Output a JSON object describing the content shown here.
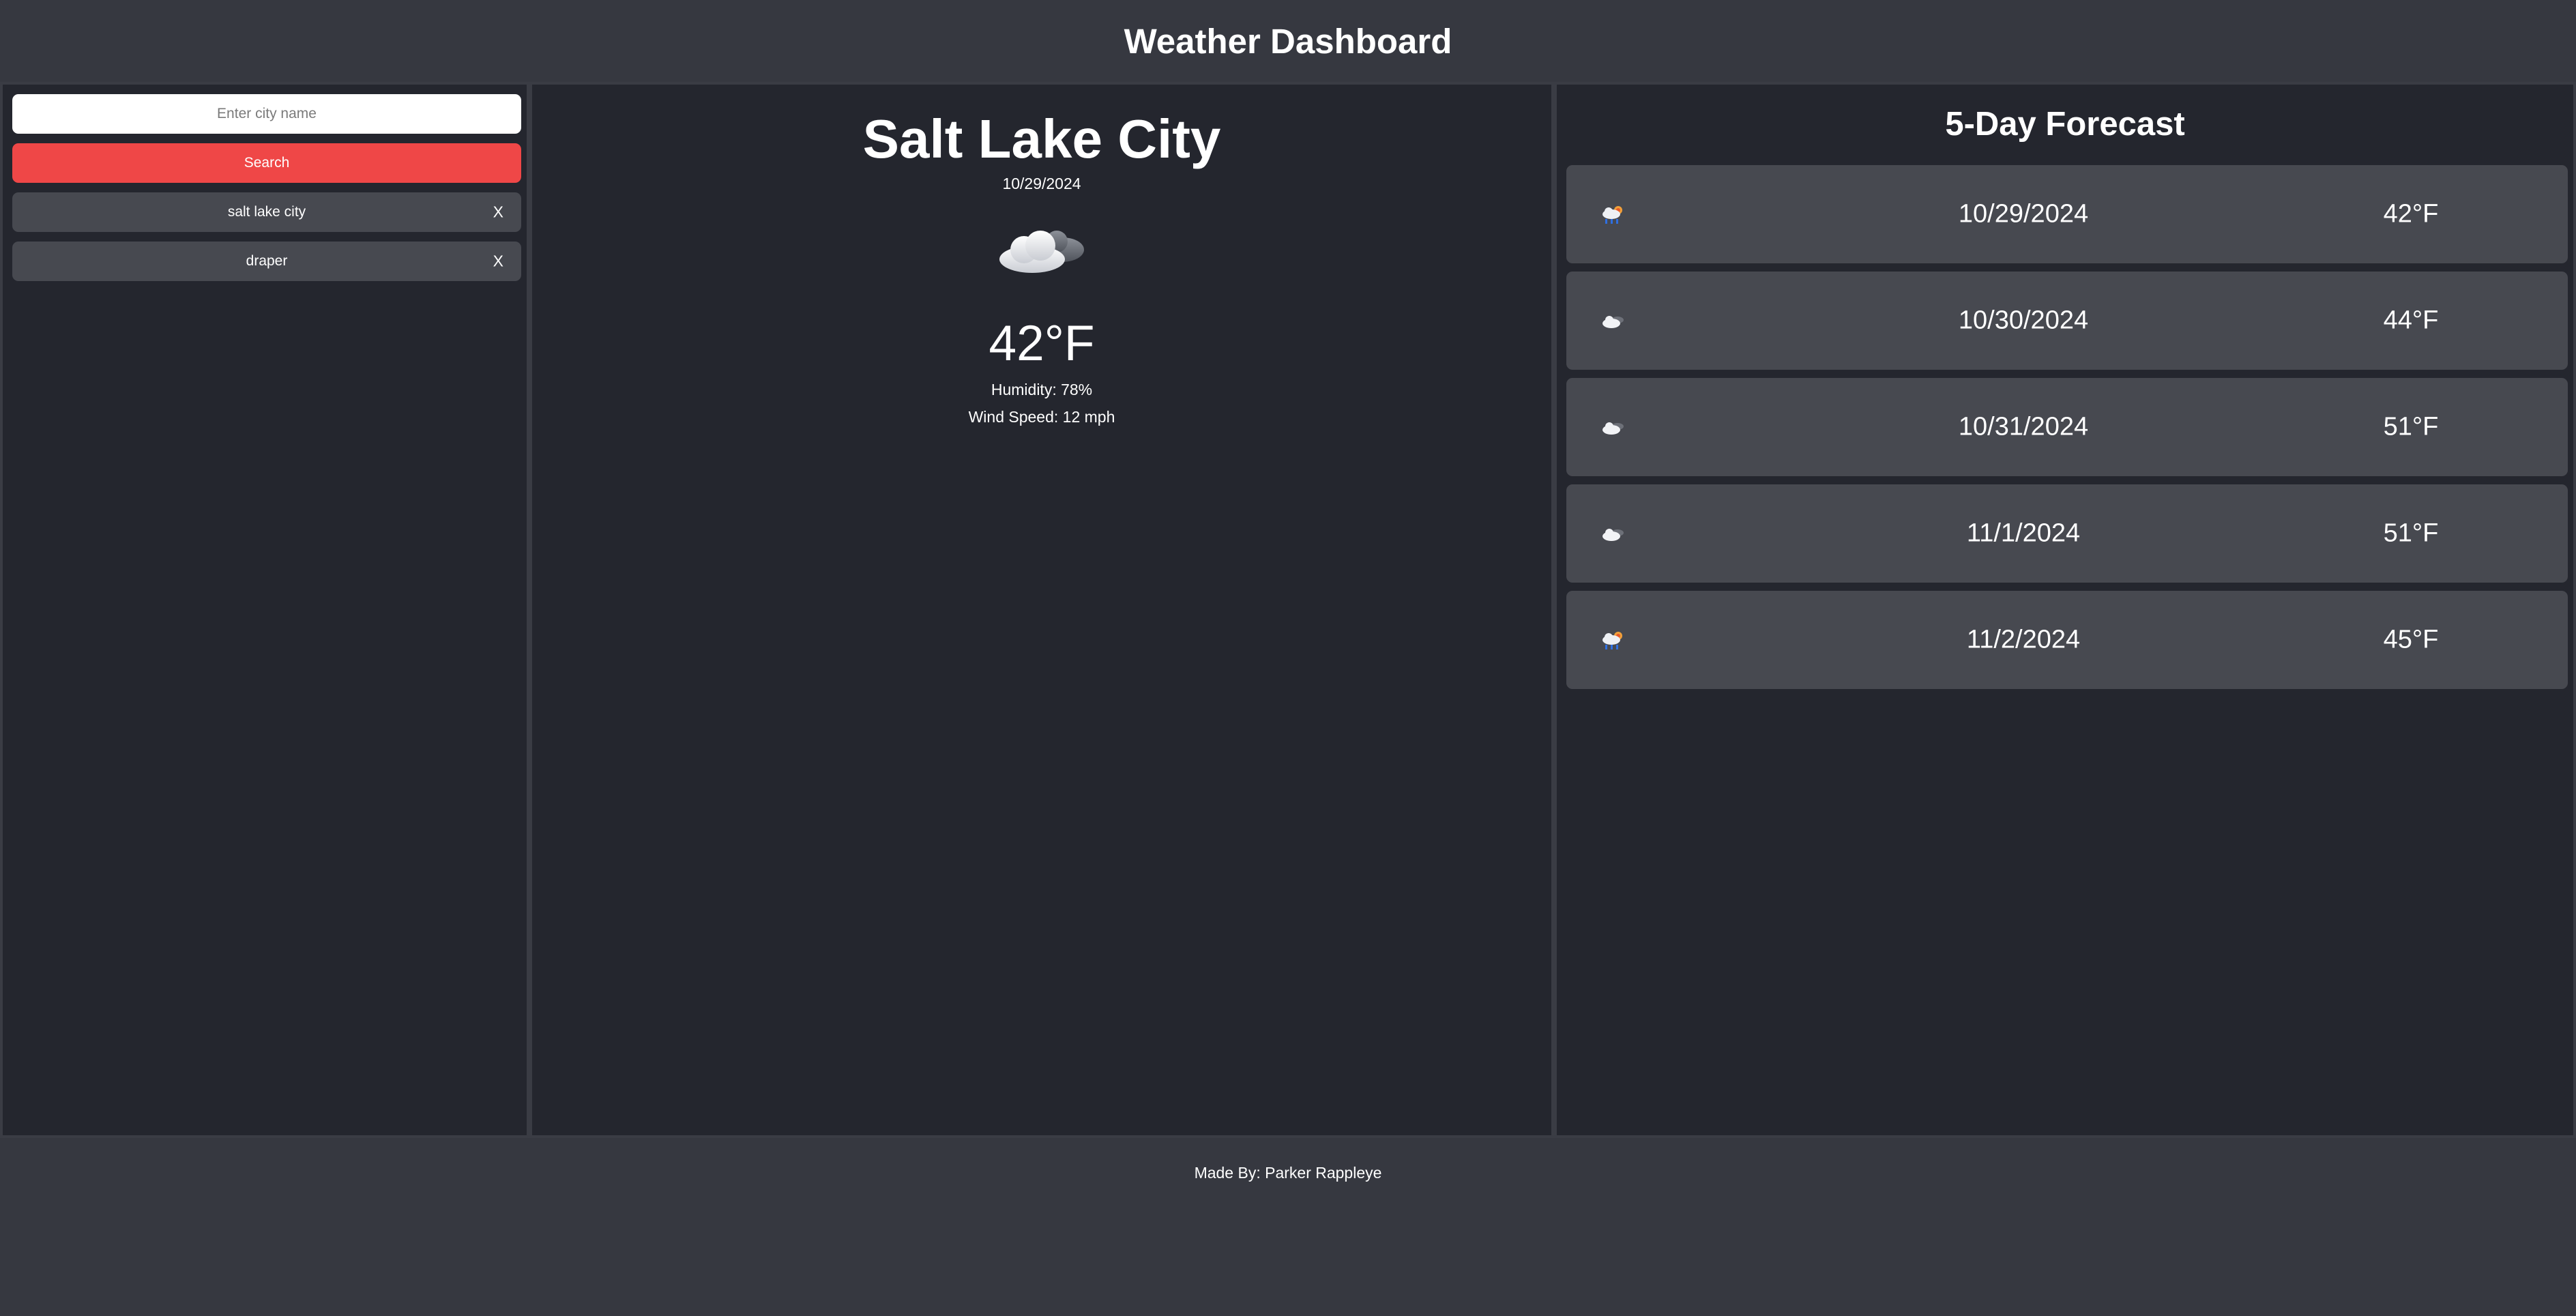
{
  "header": {
    "title": "Weather Dashboard"
  },
  "sidebar": {
    "search": {
      "placeholder": "Enter city name",
      "value": ""
    },
    "search_button_label": "Search",
    "history": [
      {
        "label": "salt lake city",
        "remove_label": "X"
      },
      {
        "label": "draper",
        "remove_label": "X"
      }
    ]
  },
  "current": {
    "city": "Salt Lake City",
    "date": "10/29/2024",
    "icon": "partly-cloudy-icon",
    "temperature": "42°F",
    "humidity": "Humidity: 78%",
    "wind": "Wind Speed: 12 mph"
  },
  "forecast": {
    "title": "5-Day Forecast",
    "days": [
      {
        "date": "10/29/2024",
        "temp": "42°F",
        "icon": "rain-icon"
      },
      {
        "date": "10/30/2024",
        "temp": "44°F",
        "icon": "partly-cloudy-icon"
      },
      {
        "date": "10/31/2024",
        "temp": "51°F",
        "icon": "partly-cloudy-icon"
      },
      {
        "date": "11/1/2024",
        "temp": "51°F",
        "icon": "partly-cloudy-icon"
      },
      {
        "date": "11/2/2024",
        "temp": "45°F",
        "icon": "rain-icon"
      }
    ]
  },
  "footer": {
    "credit": "Made By: Parker Rappleye"
  },
  "colors": {
    "background": "#363840",
    "panel": "#24262e",
    "card": "#474950",
    "accent": "#ef4747",
    "text": "#ffffff"
  }
}
